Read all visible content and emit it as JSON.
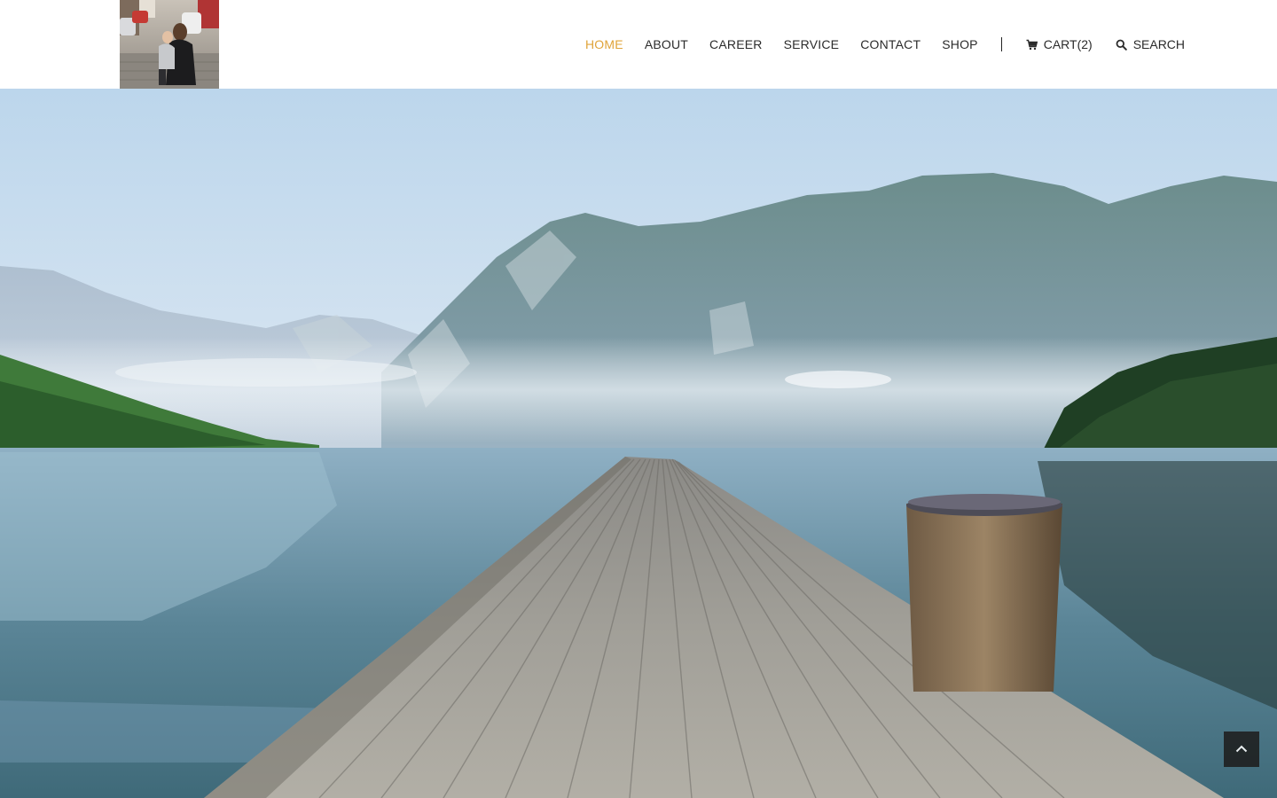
{
  "header": {
    "logo_name": "site-logo"
  },
  "nav": {
    "items": [
      {
        "label": "HOME",
        "active": true
      },
      {
        "label": "ABOUT",
        "active": false
      },
      {
        "label": "CAREER",
        "active": false
      },
      {
        "label": "SERVICE",
        "active": false
      },
      {
        "label": "CONTACT",
        "active": false
      },
      {
        "label": "SHOP",
        "active": false
      }
    ],
    "cart_label": "CART(2)",
    "cart_icon": "cart-icon",
    "search_label": "SEARCH",
    "search_icon": "search-icon"
  },
  "hero": {
    "image": "mountain-lake-dock-photo"
  },
  "back_to_top": {
    "icon": "chevron-up-icon"
  },
  "colors": {
    "accent": "#e0a43a",
    "nav_text": "#2b2b2b",
    "background": "#ffffff",
    "back_to_top_bg": "#1e1e1e"
  }
}
